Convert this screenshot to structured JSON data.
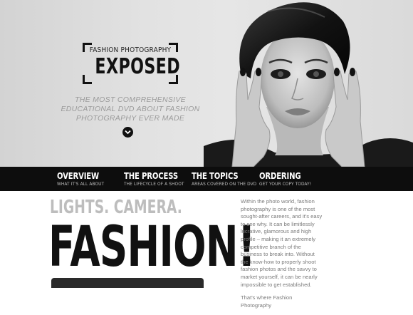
{
  "hero": {
    "kicker": "FASHION PHOTOGRAPHY",
    "brand": "EXPOSED",
    "tagline": "THE MOST COMPREHENSIVE EDUCATIONAL DVD ABOUT FASHION PHOTOGRAPHY EVER MADE",
    "scroll_icon": "chevron-down-icon"
  },
  "nav": {
    "items": [
      {
        "title": "OVERVIEW",
        "subtitle": "WHAT IT'S ALL ABOUT"
      },
      {
        "title": "THE PROCESS",
        "subtitle": "THE LIFECYCLE OF A SHOOT"
      },
      {
        "title": "THE TOPICS",
        "subtitle": "AREAS COVERED ON THE DVD"
      },
      {
        "title": "ORDERING",
        "subtitle": "GET YOUR COPY TODAY!"
      }
    ]
  },
  "content": {
    "lights": "LIGHTS. CAMERA.",
    "headline": "FASHION!",
    "paragraph1": "Within the photo world, fashion photography is one of the most sought-after careers, and it's easy to see why. It can be limitlessly lucrative, glamorous and high profile – making it an extremely competitive branch of the business to break into. Without the know-how to properly shoot fashion photos and the savvy to market yourself, it can be nearly impossible to get established.",
    "paragraph2": "That's where Fashion Photography"
  },
  "colors": {
    "nav_background": "#0d0d0d",
    "hero_background": "#e2e2e2",
    "headline": "#111111",
    "subhead": "#bdbdbd"
  }
}
